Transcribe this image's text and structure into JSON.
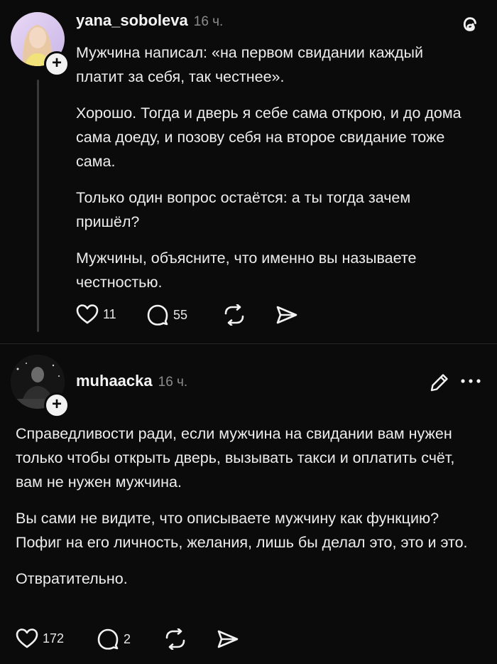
{
  "post1": {
    "username": "yana_soboleva",
    "time": "16 ч.",
    "paragraphs": [
      "Мужчина написал: «на первом свидании каждый платит за себя, так честнее».",
      "Хорошо. Тогда и дверь я себе сама открою, и до дома сама доеду, и позову себя на второе свидание тоже сама.",
      "Только один вопрос остаётся: а ты тогда зачем пришёл?",
      "Мужчины, объясните, что именно вы называете честностью."
    ],
    "likes": "11",
    "comments": "55"
  },
  "post2": {
    "username": "muhaacka",
    "time": "16 ч.",
    "paragraphs": [
      "Справедливости ради, если мужчина на свидании вам нужен только чтобы открыть дверь, вызывать такси и оплатить счёт, вам не нужен мужчина.",
      "Вы сами не видите, что описываете мужчину как функцию? Пофиг на его личность, желания, лишь бы делал это, это и это.",
      "Отвратительно."
    ],
    "likes": "172",
    "comments": "2"
  },
  "colors": {
    "background": "#0b0b0b",
    "text": "#ededed",
    "muted": "#8b8b8b"
  },
  "icons": [
    "threads-logo-icon",
    "heart-icon",
    "comment-icon",
    "repost-icon",
    "send-icon",
    "edit-icon",
    "more-icon"
  ]
}
